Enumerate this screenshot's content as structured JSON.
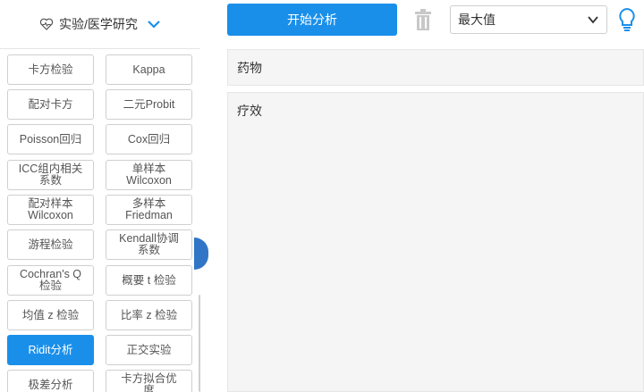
{
  "sidebar": {
    "header_label": "实验/医学研究",
    "methods": [
      {
        "label": "卡方检验"
      },
      {
        "label": "Kappa"
      },
      {
        "label": "配对卡方"
      },
      {
        "label": "二元Probit"
      },
      {
        "label": "Poisson回归"
      },
      {
        "label": "Cox回归"
      },
      {
        "label": "ICC组内相关\n系数"
      },
      {
        "label": "单样本\nWilcoxon"
      },
      {
        "label": "配对样本\nWilcoxon"
      },
      {
        "label": "多样本\nFriedman"
      },
      {
        "label": "游程检验"
      },
      {
        "label": "Kendall协调\n系数"
      },
      {
        "label": "Cochran's Q\n检验"
      },
      {
        "label": "概要 t 检验"
      },
      {
        "label": "均值 z 检验"
      },
      {
        "label": "比率 z 检验"
      },
      {
        "label": "Ridit分析",
        "active": true
      },
      {
        "label": "正交实验"
      },
      {
        "label": "极差分析"
      },
      {
        "label": "卡方拟合优\n度"
      }
    ]
  },
  "toolbar": {
    "start_label": "开始分析",
    "select_value": "最大值"
  },
  "panels": {
    "drug_label": "药物",
    "effect_label": "疗效"
  },
  "colors": {
    "accent": "#1a8fea",
    "handle": "#3176c6",
    "panel_bg": "#f5f5f5"
  }
}
